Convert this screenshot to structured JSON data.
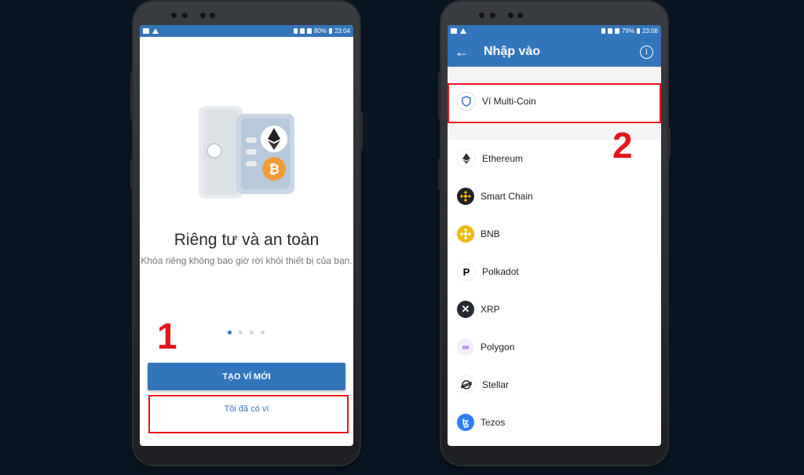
{
  "left_phone": {
    "status": {
      "battery": "80%",
      "time": "23:04"
    },
    "onboarding": {
      "title": "Riêng tư và an toàn",
      "subtitle": "Khóa riêng không bao giờ rời khỏi thiết bị của bạn.",
      "page_count": 4,
      "active_page": 1
    },
    "create_button": "TẠO VÍ MỚI",
    "have_wallet_link": "Tôi đã có ví"
  },
  "right_phone": {
    "status": {
      "battery": "79%",
      "time": "23:08"
    },
    "appbar": {
      "title": "Nhập vào"
    },
    "multicoin_label": "Ví Multi-Coin",
    "coins": [
      {
        "label": "Ethereum",
        "icon": "ethereum-icon",
        "color": "#627eea"
      },
      {
        "label": "Smart Chain",
        "icon": "smart-chain-icon",
        "color": "#f0b90b"
      },
      {
        "label": "BNB",
        "icon": "bnb-icon",
        "color": "#f0b90b"
      },
      {
        "label": "Polkadot",
        "icon": "polkadot-icon",
        "color": "#000000"
      },
      {
        "label": "XRP",
        "icon": "xrp-icon",
        "color": "#23292f"
      },
      {
        "label": "Polygon",
        "icon": "polygon-icon",
        "color": "#8247e5"
      },
      {
        "label": "Stellar",
        "icon": "stellar-icon",
        "color": "#000000"
      },
      {
        "label": "Tezos",
        "icon": "tezos-icon",
        "color": "#2c7df7"
      }
    ]
  },
  "annotations": {
    "step1": "1",
    "step2": "2"
  },
  "colors": {
    "primary": "#3375bb",
    "annotation": "#e5151d",
    "background": "#0b1624"
  }
}
